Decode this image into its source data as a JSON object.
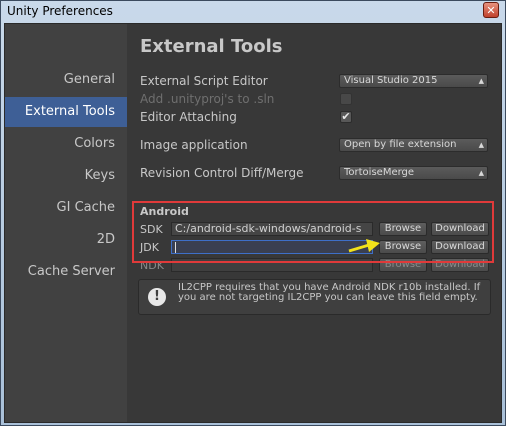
{
  "window": {
    "title": "Unity Preferences",
    "close_label": "✕"
  },
  "sidebar": {
    "items": [
      {
        "label": "General",
        "active": false
      },
      {
        "label": "External Tools",
        "active": true
      },
      {
        "label": "Colors",
        "active": false
      },
      {
        "label": "Keys",
        "active": false
      },
      {
        "label": "GI Cache",
        "active": false
      },
      {
        "label": "2D",
        "active": false
      },
      {
        "label": "Cache Server",
        "active": false
      }
    ]
  },
  "main": {
    "title": "External Tools",
    "script_editor": {
      "label": "External Script Editor",
      "value": "Visual Studio 2015"
    },
    "add_unityproj": {
      "label": "Add .unityproj's to .sln",
      "checked": false
    },
    "editor_attaching": {
      "label": "Editor Attaching",
      "checked": true,
      "mark": "✔"
    },
    "image_app": {
      "label": "Image application",
      "value": "Open by file extension"
    },
    "revision_control": {
      "label": "Revision Control Diff/Merge",
      "value": "TortoiseMerge"
    },
    "android": {
      "section_label": "Android",
      "sdk": {
        "label": "SDK",
        "value": "C:/android-sdk-windows/android-s",
        "browse": "Browse",
        "download": "Download"
      },
      "jdk": {
        "label": "JDK",
        "value": "",
        "browse": "Browse",
        "download": "Download"
      },
      "ndk": {
        "label": "NDK",
        "value": "",
        "browse": "Browse",
        "download": "Download"
      }
    },
    "help": {
      "icon": "!",
      "text": "IL2CPP requires that you have Android NDK r10b installed. If you are not targeting IL2CPP you can leave this field empty."
    }
  },
  "colors": {
    "sidebar_active": "#3e5f96",
    "annotation_box": "#e03a3a",
    "annotation_arrow": "#f2e21a"
  }
}
